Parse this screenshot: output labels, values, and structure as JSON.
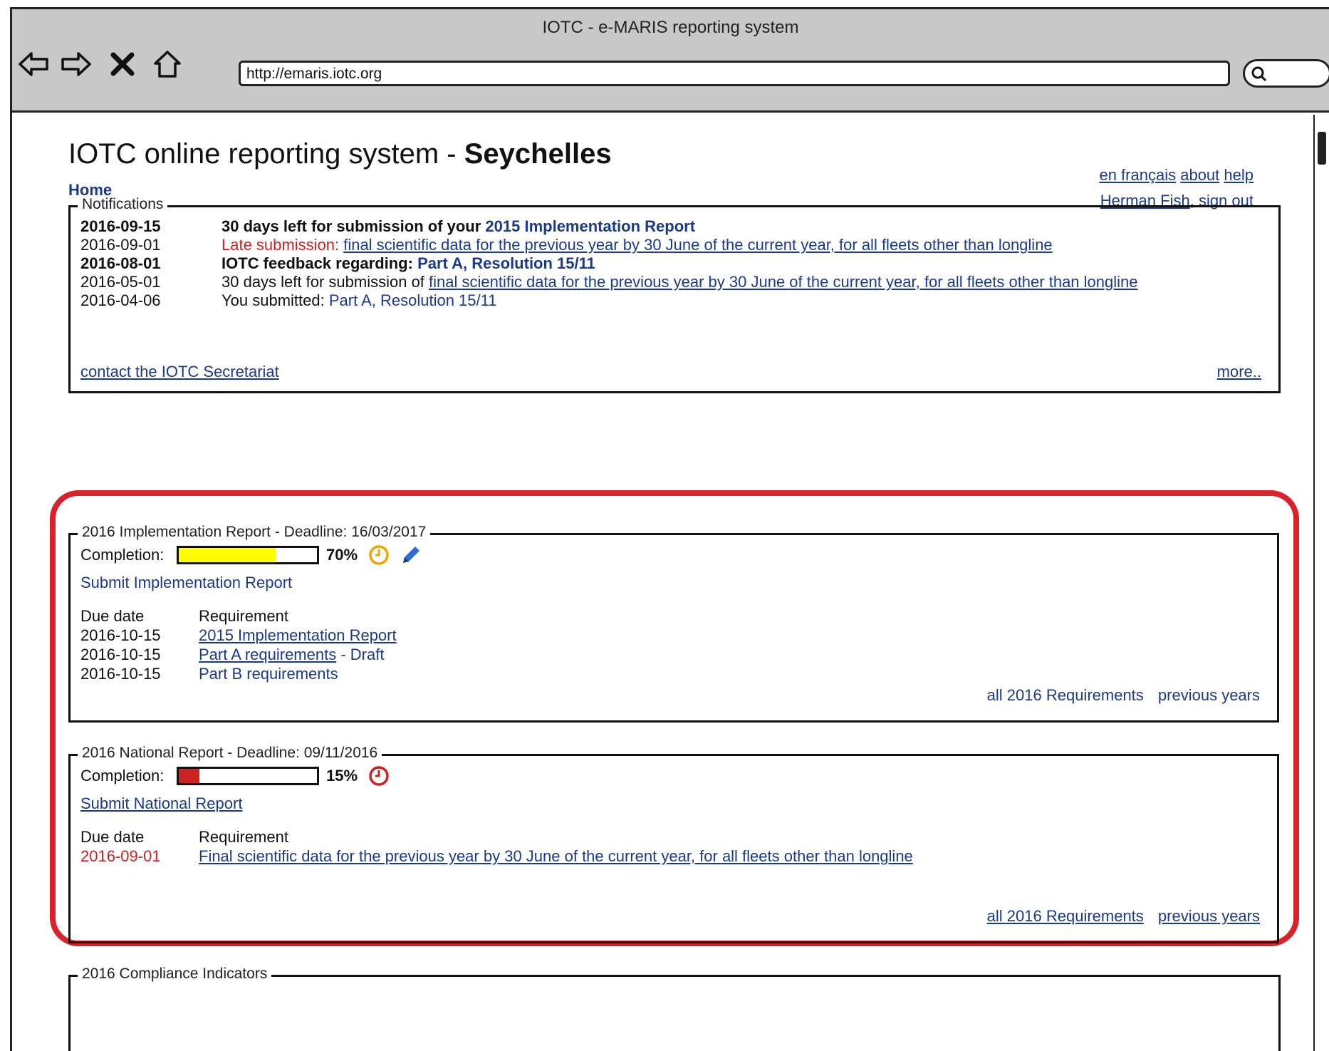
{
  "browser": {
    "title": "IOTC - e-MARIS reporting system",
    "url": "http://emaris.iotc.org"
  },
  "page": {
    "title_prefix": "IOTC online reporting system - ",
    "title_country": "Seychelles",
    "links": {
      "french": "en français",
      "about": "about",
      "help": "help",
      "user": "Herman Fish",
      "signout_sep": ", ",
      "signout": "sign out"
    },
    "breadcrumb_home": "Home"
  },
  "notifications": {
    "legend": "Notifications",
    "items": [
      {
        "date": "2016-09-15",
        "text": "30 days left for submission of your ",
        "link": "2015 Implementation Report"
      },
      {
        "date": "2016-09-01",
        "late": "Late submission: ",
        "link": "final scientific data for the previous year by 30 June of the current year, for all fleets other than longline"
      },
      {
        "date": "2016-08-01",
        "text": "IOTC feedback regarding: ",
        "link": "Part A, Resolution 15/11"
      },
      {
        "date": "2016-05-01",
        "text": "30 days left for submission of ",
        "link": "final scientific data for the previous year by 30 June of the current year, for all fleets other than longline"
      },
      {
        "date": "2016-04-06",
        "text": "You submitted: ",
        "link": "Part A, Resolution 15/11"
      }
    ],
    "contact": "contact the IOTC Secretariat",
    "more": "more.."
  },
  "implementation": {
    "legend": "2016 Implementation Report - Deadline: 16/03/2017",
    "completion_label": "Completion:",
    "completion": 0.7,
    "pct_text": "70%",
    "bar_color": "#ffff00",
    "clock_color": "#f0a500",
    "submit": "Submit Implementation Report",
    "col_due": "Due date",
    "col_req": "Requirement",
    "rows": [
      {
        "due": "2016-10-15",
        "req": "2015 Implementation Report",
        "extra": ""
      },
      {
        "due": "2016-10-15",
        "req": "Part A requirements",
        "extra": " - Draft"
      },
      {
        "due": "2016-10-15",
        "req": "Part B requirements",
        "extra": ""
      }
    ],
    "all_req": "all 2016 Requirements",
    "prev": "previous years"
  },
  "national": {
    "legend": "2016 National Report - Deadline: 09/11/2016",
    "completion_label": "Completion:",
    "completion": 0.15,
    "pct_text": "15%",
    "bar_color": "#cc2222",
    "clock_color": "#cc2222",
    "submit": "Submit National Report",
    "col_due": "Due date",
    "col_req": "Requirement",
    "rows": [
      {
        "due": "2016-09-01",
        "req": "Final scientific data for the previous year by 30 June of the current year, for all fleets other than longline"
      }
    ],
    "all_req": "all 2016 Requirements",
    "prev": "previous years"
  },
  "compliance": {
    "legend": "2016 Compliance Indicators"
  },
  "highlight_color": "#d8232a"
}
